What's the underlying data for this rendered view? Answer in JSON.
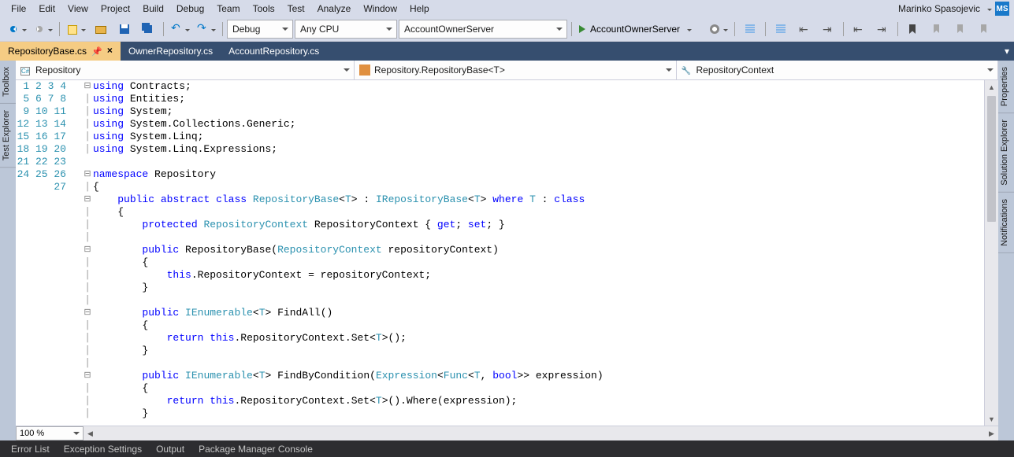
{
  "menu": [
    "File",
    "Edit",
    "View",
    "Project",
    "Build",
    "Debug",
    "Team",
    "Tools",
    "Test",
    "Analyze",
    "Window",
    "Help"
  ],
  "user": {
    "name": "Marinko Spasojevic",
    "initials": "MS"
  },
  "toolbar": {
    "config": "Debug",
    "platform": "Any CPU",
    "startup": "AccountOwnerServer",
    "run_target": "AccountOwnerServer"
  },
  "tabs": [
    {
      "label": "RepositoryBase.cs",
      "active": true,
      "pinned": true
    },
    {
      "label": "OwnerRepository.cs",
      "active": false
    },
    {
      "label": "AccountRepository.cs",
      "active": false
    }
  ],
  "navdrops": {
    "namespace": "Repository",
    "class": "Repository.RepositoryBase<T>",
    "member": "RepositoryContext"
  },
  "left_tabs": [
    "Toolbox",
    "Test Explorer"
  ],
  "right_tabs": [
    "Properties",
    "Solution Explorer",
    "Notifications"
  ],
  "zoom": "100 %",
  "bottom_tabs": [
    "Error List",
    "Exception Settings",
    "Output",
    "Package Manager Console"
  ],
  "code_lines": [
    {
      "n": 1,
      "fold": "⊟",
      "html": "<span class='k'>using</span> Contracts;"
    },
    {
      "n": 2,
      "fold": "│",
      "html": "<span class='k'>using</span> Entities;"
    },
    {
      "n": 3,
      "fold": "│",
      "html": "<span class='k'>using</span> System;"
    },
    {
      "n": 4,
      "fold": "│",
      "html": "<span class='k'>using</span> System.Collections.Generic;"
    },
    {
      "n": 5,
      "fold": "│",
      "html": "<span class='k'>using</span> System.Linq;"
    },
    {
      "n": 6,
      "fold": "│",
      "html": "<span class='k'>using</span> System.Linq.Expressions;"
    },
    {
      "n": 7,
      "fold": "",
      "html": ""
    },
    {
      "n": 8,
      "fold": "⊟",
      "html": "<span class='k'>namespace</span> Repository"
    },
    {
      "n": 9,
      "fold": "│",
      "html": "{"
    },
    {
      "n": 10,
      "fold": "⊟",
      "html": "    <span class='k'>public</span> <span class='k'>abstract</span> <span class='k'>class</span> <span class='t'>RepositoryBase</span>&lt;<span class='t'>T</span>&gt; : <span class='t'>IRepositoryBase</span>&lt;<span class='t'>T</span>&gt; <span class='k'>where</span> <span class='t'>T</span> : <span class='k'>class</span>"
    },
    {
      "n": 11,
      "fold": "│",
      "html": "    {"
    },
    {
      "n": 12,
      "fold": "│",
      "html": "        <span class='k'>protected</span> <span class='t'>RepositoryContext</span> RepositoryContext { <span class='k'>get</span>; <span class='k'>set</span>; }"
    },
    {
      "n": 13,
      "fold": "│",
      "html": ""
    },
    {
      "n": 14,
      "fold": "⊟",
      "html": "        <span class='k'>public</span> RepositoryBase(<span class='t'>RepositoryContext</span> repositoryContext)"
    },
    {
      "n": 15,
      "fold": "│",
      "html": "        {"
    },
    {
      "n": 16,
      "fold": "│",
      "html": "            <span class='k'>this</span>.RepositoryContext = repositoryContext;"
    },
    {
      "n": 17,
      "fold": "│",
      "html": "        }"
    },
    {
      "n": 18,
      "fold": "│",
      "html": ""
    },
    {
      "n": 19,
      "fold": "⊟",
      "html": "        <span class='k'>public</span> <span class='t'>IEnumerable</span>&lt;<span class='t'>T</span>&gt; FindAll()"
    },
    {
      "n": 20,
      "fold": "│",
      "html": "        {"
    },
    {
      "n": 21,
      "fold": "│",
      "html": "            <span class='k'>return</span> <span class='k'>this</span>.RepositoryContext.Set&lt;<span class='t'>T</span>&gt;();"
    },
    {
      "n": 22,
      "fold": "│",
      "html": "        }"
    },
    {
      "n": 23,
      "fold": "│",
      "html": ""
    },
    {
      "n": 24,
      "fold": "⊟",
      "html": "        <span class='k'>public</span> <span class='t'>IEnumerable</span>&lt;<span class='t'>T</span>&gt; FindByCondition(<span class='t'>Expression</span>&lt;<span class='t'>Func</span>&lt;<span class='t'>T</span>, <span class='k'>bool</span>&gt;&gt; expression)"
    },
    {
      "n": 25,
      "fold": "│",
      "html": "        {"
    },
    {
      "n": 26,
      "fold": "│",
      "html": "            <span class='k'>return</span> <span class='k'>this</span>.RepositoryContext.Set&lt;<span class='t'>T</span>&gt;().Where(expression);"
    },
    {
      "n": 27,
      "fold": "│",
      "html": "        }"
    }
  ]
}
